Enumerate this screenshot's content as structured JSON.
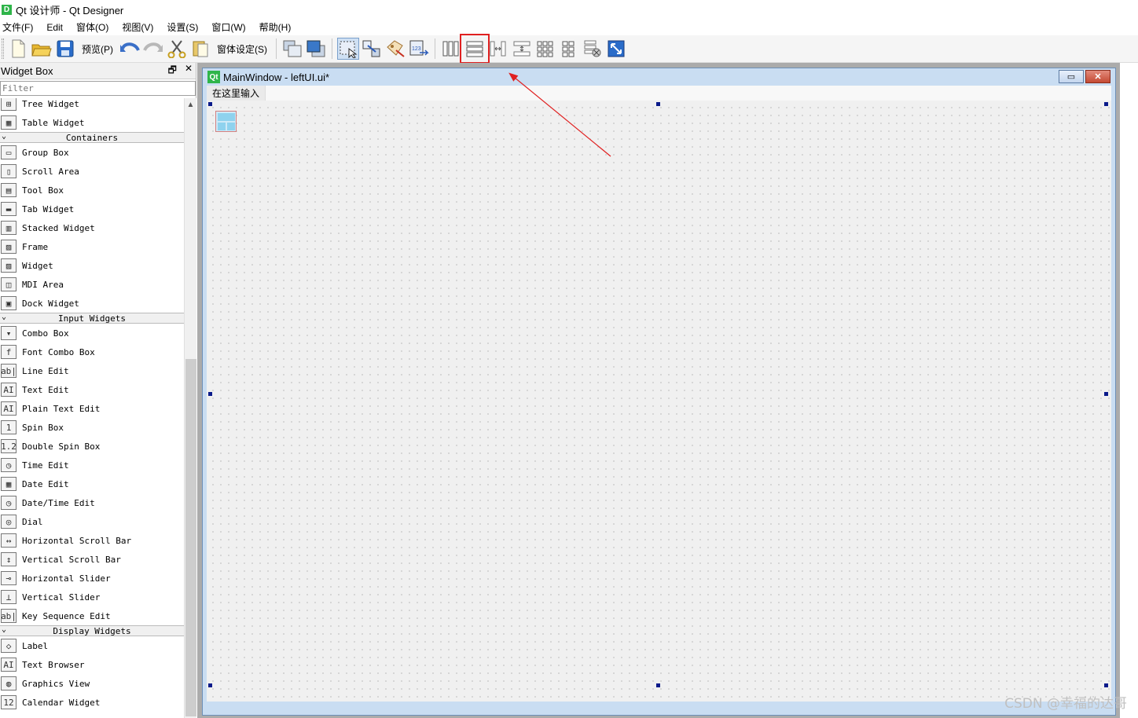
{
  "window": {
    "app_icon": "D",
    "title": "Qt 设计师 - Qt Designer"
  },
  "menubar": [
    "文件(F)",
    "Edit",
    "窗体(O)",
    "视图(V)",
    "设置(S)",
    "窗口(W)",
    "帮助(H)"
  ],
  "toolbar": {
    "preview_label": "预览(P)",
    "form_settings_label": "窗体设定(S)",
    "highlighted_icon": "layout-vertical-icon"
  },
  "widget_box": {
    "title": "Widget Box",
    "float_icon": "🗗",
    "close_icon": "✕",
    "filter_placeholder": "Filter",
    "sections": [
      {
        "type": "items",
        "items": [
          {
            "label": "Tree Widget",
            "icon": "tree-widget-icon",
            "glyph": "⊞"
          },
          {
            "label": "Table Widget",
            "icon": "table-widget-icon",
            "glyph": "▦"
          }
        ]
      },
      {
        "type": "category",
        "label": "Containers"
      },
      {
        "type": "items",
        "items": [
          {
            "label": "Group Box",
            "icon": "group-box-icon",
            "glyph": "▭"
          },
          {
            "label": "Scroll Area",
            "icon": "scroll-area-icon",
            "glyph": "▯"
          },
          {
            "label": "Tool Box",
            "icon": "tool-box-icon",
            "glyph": "▤"
          },
          {
            "label": "Tab Widget",
            "icon": "tab-widget-icon",
            "glyph": "▬"
          },
          {
            "label": "Stacked Widget",
            "icon": "stacked-widget-icon",
            "glyph": "▥"
          },
          {
            "label": "Frame",
            "icon": "frame-icon",
            "glyph": "▨"
          },
          {
            "label": "Widget",
            "icon": "widget-icon",
            "glyph": "▨"
          },
          {
            "label": "MDI Area",
            "icon": "mdi-area-icon",
            "glyph": "◫"
          },
          {
            "label": "Dock Widget",
            "icon": "dock-widget-icon",
            "glyph": "▣"
          }
        ]
      },
      {
        "type": "category",
        "label": "Input Widgets"
      },
      {
        "type": "items",
        "items": [
          {
            "label": "Combo Box",
            "icon": "combo-box-icon",
            "glyph": "▾"
          },
          {
            "label": "Font Combo Box",
            "icon": "font-combo-box-icon",
            "glyph": "f"
          },
          {
            "label": "Line Edit",
            "icon": "line-edit-icon",
            "glyph": "ab|"
          },
          {
            "label": "Text Edit",
            "icon": "text-edit-icon",
            "glyph": "AI"
          },
          {
            "label": "Plain Text Edit",
            "icon": "plain-text-edit-icon",
            "glyph": "AI"
          },
          {
            "label": "Spin Box",
            "icon": "spin-box-icon",
            "glyph": "1"
          },
          {
            "label": "Double Spin Box",
            "icon": "double-spin-box-icon",
            "glyph": "1.2"
          },
          {
            "label": "Time Edit",
            "icon": "time-edit-icon",
            "glyph": "◷"
          },
          {
            "label": "Date Edit",
            "icon": "date-edit-icon",
            "glyph": "▦"
          },
          {
            "label": "Date/Time Edit",
            "icon": "datetime-edit-icon",
            "glyph": "◷"
          },
          {
            "label": "Dial",
            "icon": "dial-icon",
            "glyph": "◎"
          },
          {
            "label": "Horizontal Scroll Bar",
            "icon": "horizontal-scroll-bar-icon",
            "glyph": "↔"
          },
          {
            "label": "Vertical Scroll Bar",
            "icon": "vertical-scroll-bar-icon",
            "glyph": "↕"
          },
          {
            "label": "Horizontal Slider",
            "icon": "horizontal-slider-icon",
            "glyph": "⊸"
          },
          {
            "label": "Vertical Slider",
            "icon": "vertical-slider-icon",
            "glyph": "⊥"
          },
          {
            "label": "Key Sequence Edit",
            "icon": "key-sequence-edit-icon",
            "glyph": "ab|"
          }
        ]
      },
      {
        "type": "category",
        "label": "Display Widgets"
      },
      {
        "type": "items",
        "items": [
          {
            "label": "Label",
            "icon": "label-icon",
            "glyph": "◇"
          },
          {
            "label": "Text Browser",
            "icon": "text-browser-icon",
            "glyph": "AI"
          },
          {
            "label": "Graphics View",
            "icon": "graphics-view-icon",
            "glyph": "◍"
          },
          {
            "label": "Calendar Widget",
            "icon": "calendar-widget-icon",
            "glyph": "12"
          }
        ]
      }
    ]
  },
  "subwindow": {
    "icon": "Qt",
    "title": "MainWindow - leftUI.ui*",
    "minimize": "▭",
    "close": "✕",
    "form_menu_placeholder": "在这里输入"
  },
  "watermark": "CSDN @幸福的达哥",
  "colors": {
    "highlight_box": "#e02020",
    "arrow": "#e02020",
    "handle": "#0a1a8a"
  }
}
